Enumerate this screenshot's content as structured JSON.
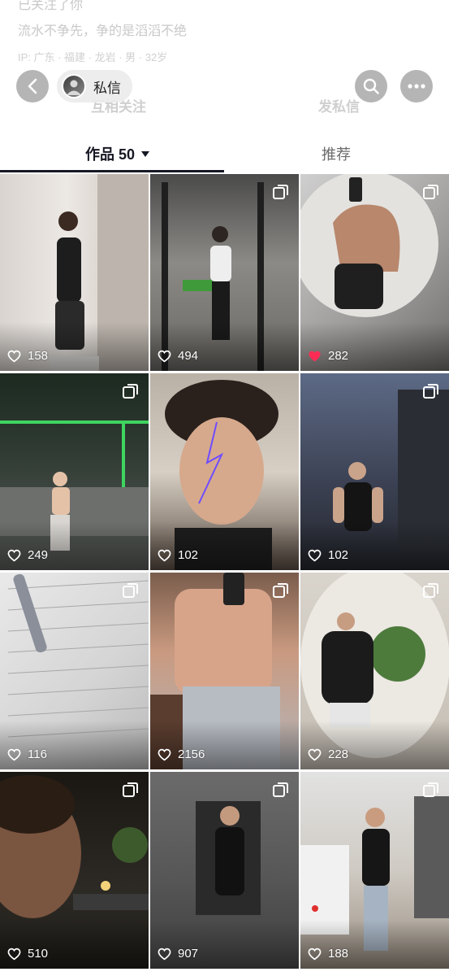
{
  "profile": {
    "follow_line": "已关注了你",
    "bio": "流水不争先，争的是滔滔不绝",
    "meta": "IP: 广东 · 福建 · 龙岩 · 男 · 32岁",
    "mutual": "互相关注",
    "message": "发私信"
  },
  "topbar": {
    "chip_label": "私信"
  },
  "tabs": {
    "works_label": "作品 50",
    "recommend_label": "推荐"
  },
  "colors": {
    "liked": "#fe2c55",
    "tab_active": "#161823"
  },
  "grid": [
    {
      "likes": "158",
      "liked": false,
      "multi": false
    },
    {
      "likes": "494",
      "liked": false,
      "multi": true
    },
    {
      "likes": "282",
      "liked": true,
      "multi": true
    },
    {
      "likes": "249",
      "liked": false,
      "multi": true
    },
    {
      "likes": "102",
      "liked": false,
      "multi": false
    },
    {
      "likes": "102",
      "liked": false,
      "multi": true
    },
    {
      "likes": "116",
      "liked": false,
      "multi": true
    },
    {
      "likes": "2156",
      "liked": false,
      "multi": true
    },
    {
      "likes": "228",
      "liked": false,
      "multi": true
    },
    {
      "likes": "510",
      "liked": false,
      "multi": true
    },
    {
      "likes": "907",
      "liked": false,
      "multi": true
    },
    {
      "likes": "188",
      "liked": false,
      "multi": true
    }
  ]
}
